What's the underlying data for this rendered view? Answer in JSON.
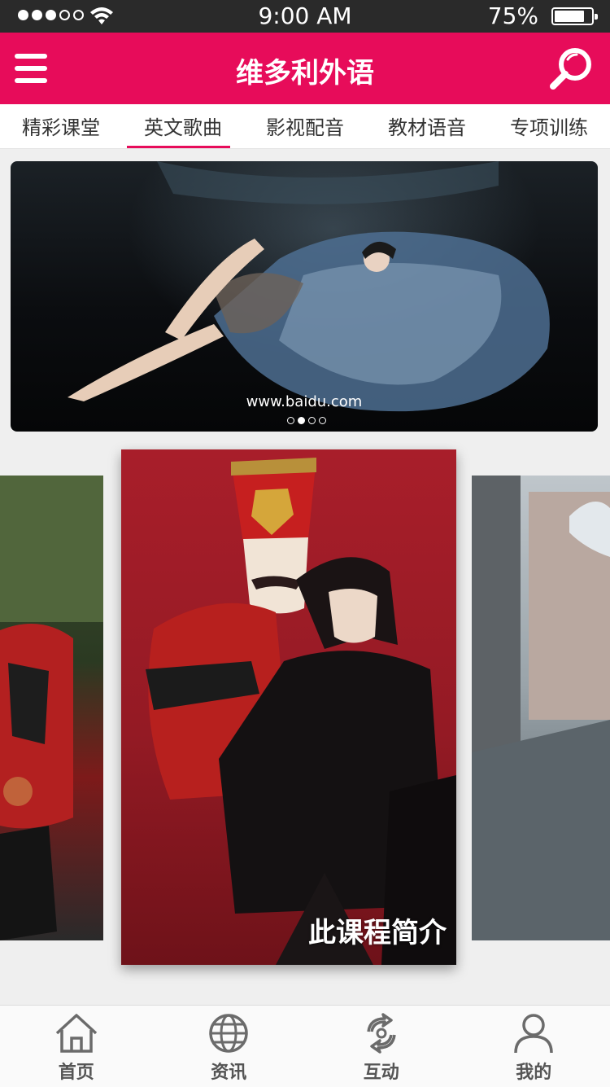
{
  "status_bar": {
    "time": "9:00 AM",
    "battery_percent": "75%",
    "signal_bars_filled": 3,
    "signal_bars_total": 5,
    "battery_level": 0.75
  },
  "header": {
    "title": "维多利外语",
    "brand_color": "#e70c5a",
    "menu_icon": "hamburger-menu-icon",
    "search_icon": "search-icon"
  },
  "tabs": [
    {
      "label": "精彩课堂",
      "active": false
    },
    {
      "label": "英文歌曲",
      "active": true
    },
    {
      "label": "影视配音",
      "active": false
    },
    {
      "label": "教材语音",
      "active": false
    },
    {
      "label": "专项训练",
      "active": false
    }
  ],
  "banner": {
    "caption": "www.baidu.com",
    "slide_count": 4,
    "active_slide_index": 1
  },
  "cards": {
    "center_caption": "此课程简介"
  },
  "bottom_nav": [
    {
      "label": "首页",
      "icon": "home-icon"
    },
    {
      "label": "资讯",
      "icon": "globe-icon"
    },
    {
      "label": "互动",
      "icon": "sync-icon"
    },
    {
      "label": "我的",
      "icon": "user-icon"
    }
  ]
}
